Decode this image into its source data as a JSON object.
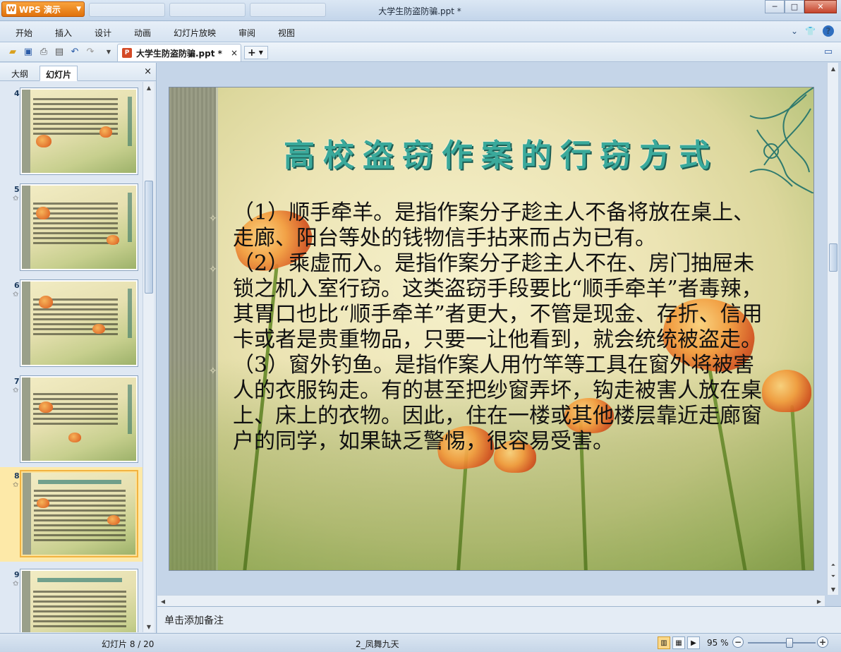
{
  "titlebar": {
    "app_label": "WPS 演示",
    "app_logo": "W",
    "window_title": "大学生防盗防骗.ppt *",
    "controls": [
      "─",
      "□",
      "✕"
    ]
  },
  "menu": {
    "items": [
      "开始",
      "插入",
      "设计",
      "动画",
      "幻灯片放映",
      "审阅",
      "视图"
    ]
  },
  "toolbar": {
    "doc_tab_label": "大学生防盗防骗.ppt *",
    "doc_tab_icon": "P",
    "close_glyph": "×",
    "new_tab_glyph": "+"
  },
  "panel": {
    "tabs": [
      "大纲",
      "幻灯片"
    ],
    "active_tab": "幻灯片",
    "close_glyph": "×",
    "thumbnails": [
      {
        "num": "4",
        "star": ""
      },
      {
        "num": "5",
        "star": "✩"
      },
      {
        "num": "6",
        "star": "✩"
      },
      {
        "num": "7",
        "star": "✩"
      },
      {
        "num": "8",
        "star": "✩"
      },
      {
        "num": "9",
        "star": "✩"
      }
    ],
    "selected_index": 4
  },
  "slide": {
    "title": "高校盗窃作案的行窃方式",
    "paragraphs": [
      "（1）顺手牵羊。是指作案分子趁主人不备将放在桌上、走廊、阳台等处的钱物信手拈来而占为已有。",
      "（2）乘虚而入。是指作案分子趁主人不在、房门抽屉未锁之机入室行窃。这类盗窃手段要比“顺手牵羊”者毒辣，其胃口也比“顺手牵羊”者更大，不管是现金、存折、信用卡或者是贵重物品，只要一让他看到，就会统统被盗走。",
      "（3）窗外钓鱼。是指作案人用竹竿等工具在窗外将被害人的衣服钩走。有的甚至把纱窗弄坏，钩走被害人放在桌上、床上的衣物。因此，住在一楼或其他楼层靠近走廊窗户的同学，如果缺乏警惕，很容易受害。"
    ],
    "colors": {
      "title": "#3aa99b",
      "body": "#111111",
      "flower": "#e8752a"
    }
  },
  "notes": {
    "placeholder": "单击添加备注"
  },
  "status": {
    "slide_counter": "幻灯片 8 / 20",
    "theme_name": "2_凤舞九天",
    "zoom": "95 %",
    "zoom_value": 95
  }
}
